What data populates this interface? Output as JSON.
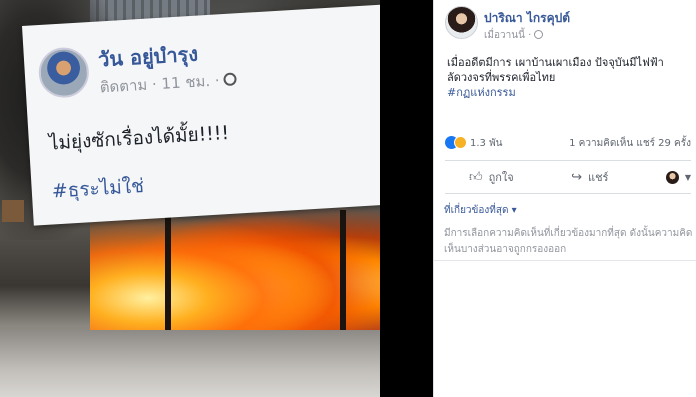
{
  "photo_post": {
    "author": "วัน อยู่บำรุง",
    "meta": "ติดตาม · 11 ชม. ·",
    "message": "ไม่ยุ่งซักเรื่องได้มั้ย!!!!",
    "hashtag": "#ธุระไม่ใช่",
    "icons": {
      "privacy": "globe-icon"
    }
  },
  "fb_post": {
    "author": "ปาริณา ไกรคุปต์",
    "time": "เมื่อวานนี้ ·",
    "body": "เมื่ออดีตมีการ เผาบ้านเผาเมือง ปัจจุบันมีไฟฟ้าลัดวงจรที่พรรคเพื่อไทย",
    "hashtag": "#กฏแห่งกรรม",
    "reactions_count": "1.3 พัน",
    "comments_shares": "1 ความคิดเห็น  แชร์ 29 ครั้ง",
    "actions": {
      "like": "ถูกใจ",
      "share": "แชร์"
    },
    "relevant_label": "ที่เกี่ยวข้องที่สุด ▾",
    "notice": "มีการเลือกความคิดเห็นที่เกี่ยวข้องมากที่สุด ดังนั้นความคิดเห็นบางส่วนอาจถูกกรองออก",
    "colors": {
      "link": "#385898",
      "like_blue": "#1877f2",
      "haha_yellow": "#f7b125"
    }
  }
}
